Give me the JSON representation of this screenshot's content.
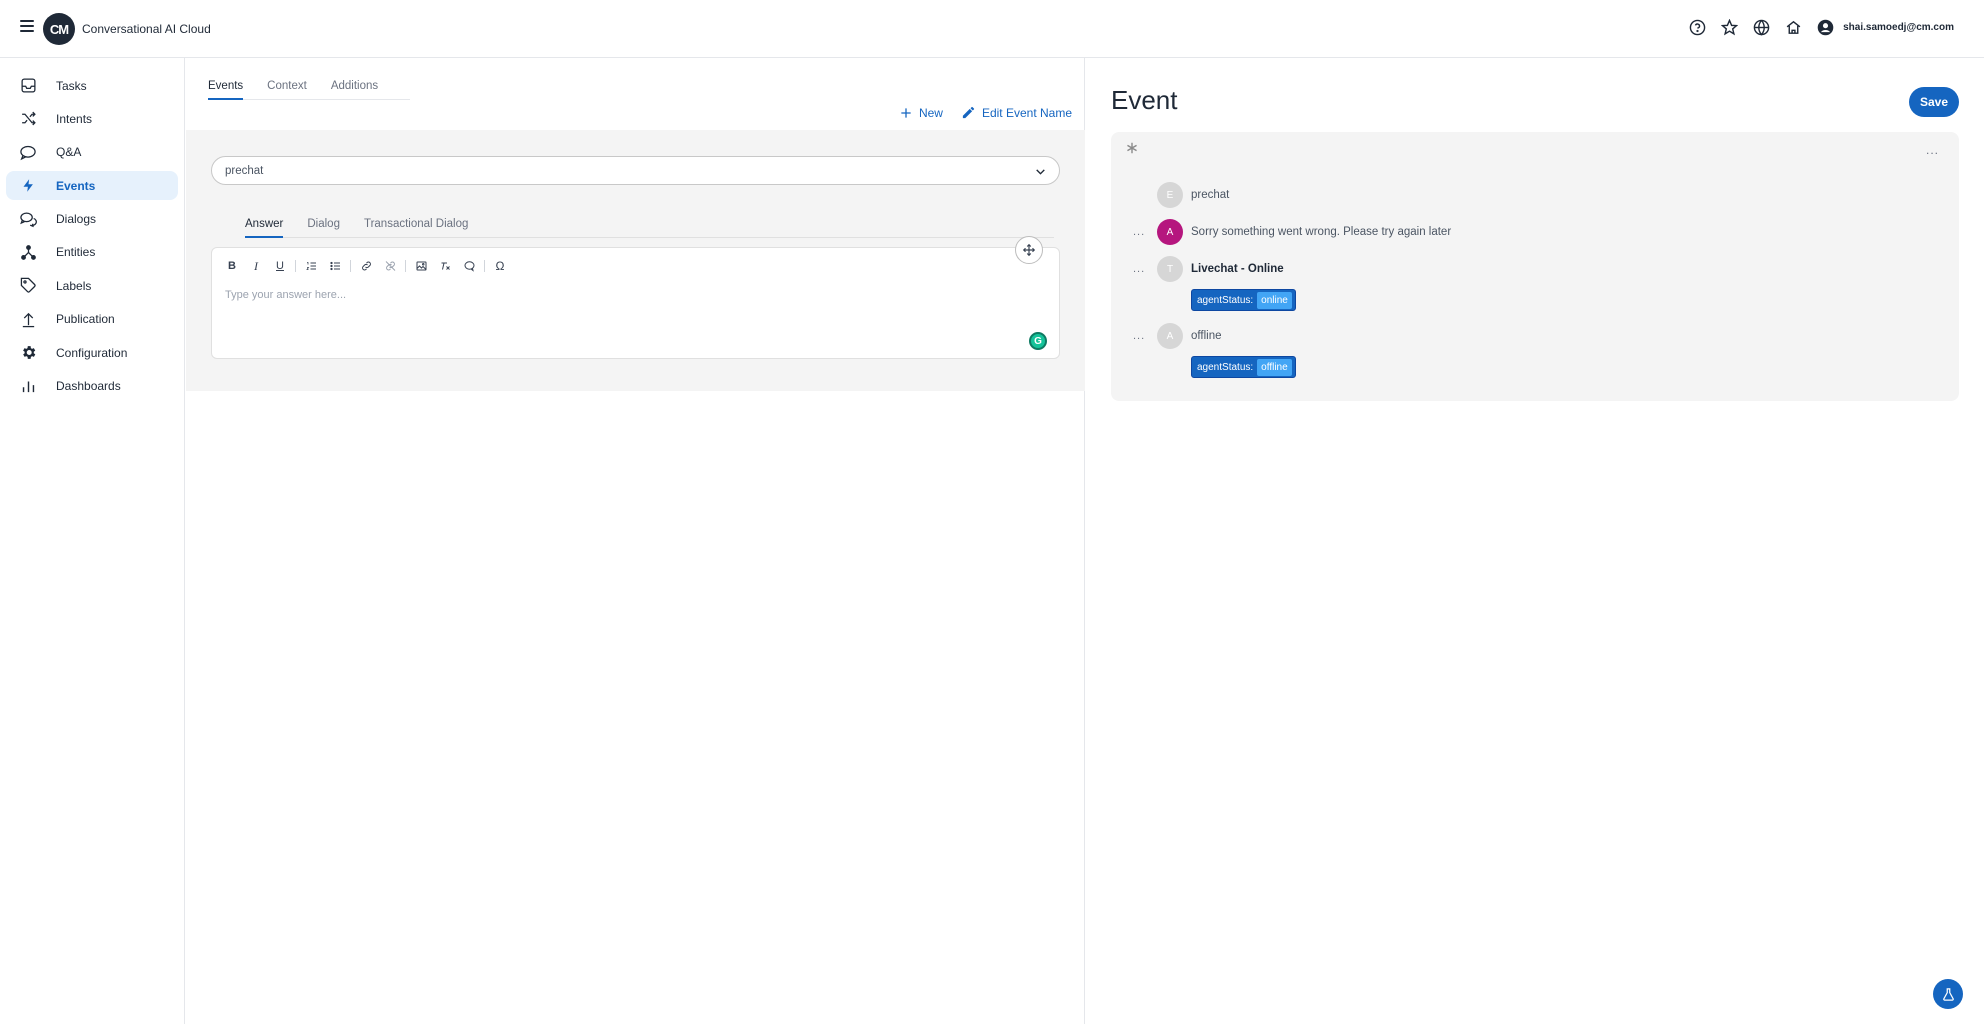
{
  "header": {
    "app_title": "Conversational AI Cloud",
    "logo_text": "CM",
    "user_email": "shai.samoedj@cm.com",
    "icons": [
      "help-icon",
      "star-icon",
      "globe-icon",
      "home-icon",
      "account-icon"
    ]
  },
  "sidebar": {
    "items": [
      {
        "label": "Tasks",
        "icon": "inbox-icon"
      },
      {
        "label": "Intents",
        "icon": "shuffle-icon"
      },
      {
        "label": "Q&A",
        "icon": "chat-bubble-icon"
      },
      {
        "label": "Events",
        "icon": "lightning-icon",
        "active": true
      },
      {
        "label": "Dialogs",
        "icon": "dialogs-icon"
      },
      {
        "label": "Entities",
        "icon": "entities-icon"
      },
      {
        "label": "Labels",
        "icon": "tag-icon"
      },
      {
        "label": "Publication",
        "icon": "upload-icon"
      },
      {
        "label": "Configuration",
        "icon": "gear-icon"
      },
      {
        "label": "Dashboards",
        "icon": "bar-chart-icon"
      }
    ]
  },
  "middle": {
    "tabs": [
      "Events",
      "Context",
      "Additions"
    ],
    "active_tab": "Events",
    "actions": {
      "new_label": "New",
      "edit_label": "Edit Event Name"
    },
    "select_value": "prechat",
    "inner_tabs": [
      "Answer",
      "Dialog",
      "Transactional Dialog"
    ],
    "editor_placeholder": "Type your answer here...",
    "toolbar": {
      "bold": "B",
      "italic": "I",
      "underline": "U",
      "special_char": "Ω"
    },
    "grammarly": "G"
  },
  "right": {
    "title": "Event",
    "save_label": "Save",
    "flow": [
      {
        "avatar": "E",
        "text": "prechat",
        "bold": false,
        "has_menu": false,
        "pink": false
      },
      {
        "avatar": "A",
        "text": "Sorry something went wrong. Please try again later",
        "bold": false,
        "has_menu": true,
        "pink": true
      },
      {
        "avatar": "T",
        "text": "Livechat - Online",
        "bold": true,
        "has_menu": true,
        "pink": false,
        "tag_key": "agentStatus:",
        "tag_value": "online"
      },
      {
        "avatar": "A",
        "text": "offline",
        "bold": false,
        "has_menu": true,
        "pink": false,
        "tag_key": "agentStatus:",
        "tag_value": "offline"
      }
    ]
  },
  "colors": {
    "accent": "#1565c0",
    "active_nav_bg": "#e6f1fc",
    "panel_grey": "#f4f4f4",
    "avatar_pink": "#b5167e",
    "tag_value_bg": "#42a5f5"
  }
}
